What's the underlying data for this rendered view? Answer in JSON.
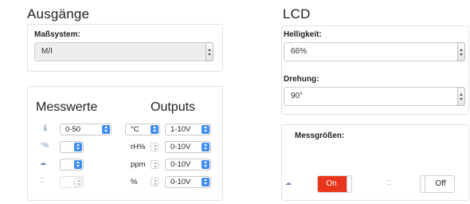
{
  "outputs_section": {
    "title": "Ausgänge",
    "unit_system_label": "Maßsystem:",
    "unit_system_value": "M/I",
    "measure_heading": "Messwerte",
    "outputs_heading": "Outputs",
    "rows": [
      {
        "icon": "thermometer-icon",
        "range": "0-50",
        "unit": "°C",
        "output": "1-10V"
      },
      {
        "icon": "humidity-icon",
        "range": "",
        "unit": "rH%",
        "output": "0-10V"
      },
      {
        "icon": "co2-icon",
        "range": "",
        "unit": "ppm",
        "output": "0-10V"
      },
      {
        "icon": "particle-icon",
        "range": "",
        "unit": "%",
        "output": "0-10V"
      }
    ]
  },
  "lcd_section": {
    "title": "LCD",
    "brightness_label": "Helligkeit:",
    "brightness_value": "66%",
    "rotation_label": "Drehung:",
    "rotation_value": "90°",
    "measurands_label": "Messgrößen:",
    "toggles": [
      {
        "icon": "co2-icon",
        "label": "On",
        "state": "on",
        "color": "#e8361c"
      },
      {
        "icon": "particle-icon",
        "label": "Off",
        "state": "off"
      }
    ]
  },
  "colors": {
    "accent_blue": "#3d8cf0",
    "toggle_on": "#e8361c"
  }
}
